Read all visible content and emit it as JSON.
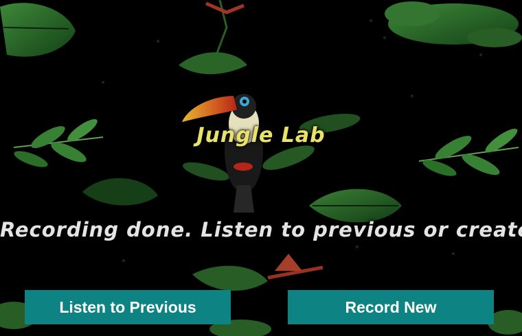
{
  "app": {
    "title": "Jungle Lab"
  },
  "status": {
    "message": "Recording done. Listen to previous or create new one."
  },
  "buttons": {
    "listen_previous": "Listen to Previous",
    "record_new": "Record New"
  },
  "colors": {
    "background": "#000000",
    "title": "#e9e26a",
    "status_text": "#e4e4e4",
    "button_bg": "#0e8384",
    "button_text": "#ffffff",
    "leaf_dark": "#1f5a22",
    "leaf_light": "#3f8f3a"
  },
  "decor": {
    "background_art": "jungle-foliage",
    "bird": "toucan-icon"
  }
}
